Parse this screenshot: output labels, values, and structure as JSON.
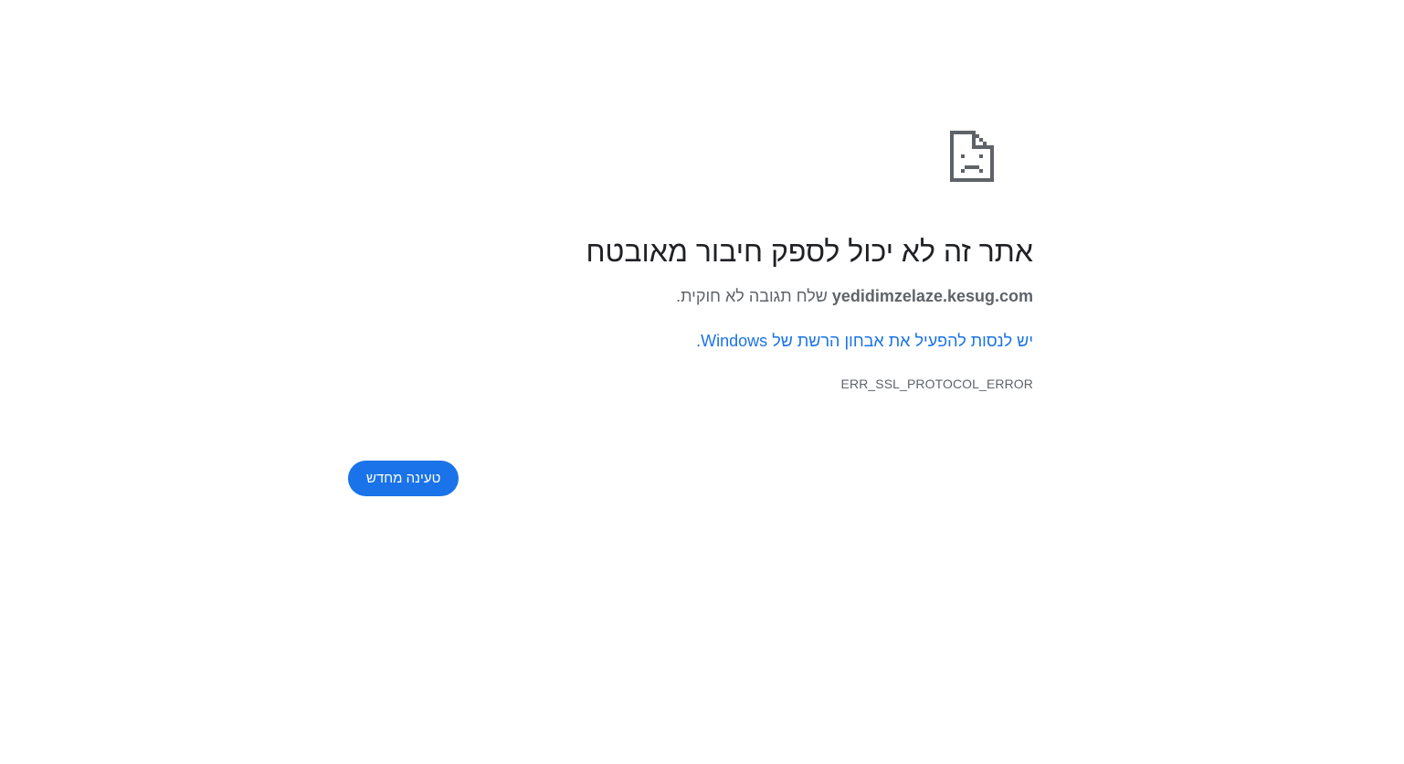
{
  "error_page": {
    "icon": "sad-page-icon",
    "title": "אתר זה לא יכול לספק חיבור מאובטח",
    "host": "yedidimzelaze.kesug.com",
    "description_suffix": " שלח תגובה לא חוקית.",
    "suggestion_link": "יש לנסות להפעיל את אבחון הרשת של Windows.",
    "error_code": "ERR_SSL_PROTOCOL_ERROR",
    "reload_button": "טעינה מחדש"
  },
  "colors": {
    "accent": "#1a73e8",
    "title": "#202124",
    "secondary_text": "#5f6368",
    "icon": "#5f6368",
    "background": "#ffffff"
  }
}
